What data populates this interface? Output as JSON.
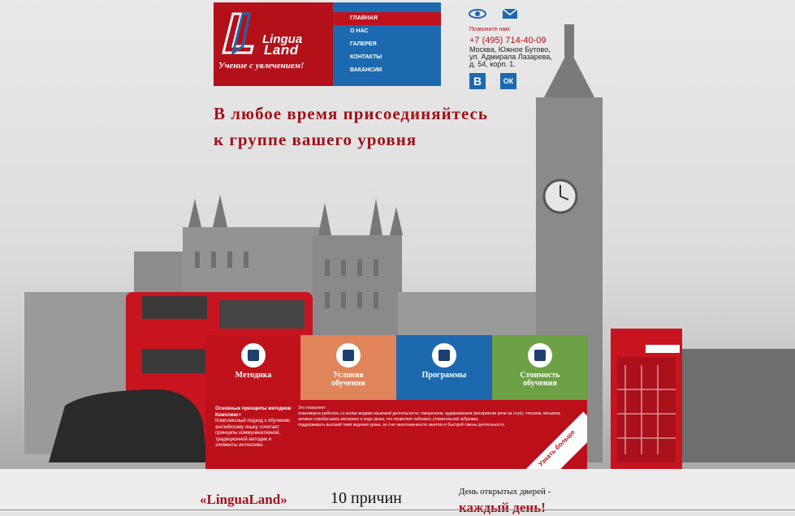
{
  "logo": {
    "line1": "Lingua",
    "line2": "Land",
    "slogan": "Учение с увлечением!"
  },
  "nav": {
    "items": [
      {
        "label": "ГЛАВНАЯ",
        "active": true
      },
      {
        "label": "О НАС",
        "active": false
      },
      {
        "label": "ГАЛЕРЕЯ",
        "active": false
      },
      {
        "label": "КОНТАКТЫ",
        "active": false
      },
      {
        "label": "ВАКАНСИИ",
        "active": false
      }
    ]
  },
  "contacts": {
    "call_label": "Позвоните нам:",
    "phone": "+7 (495) 714-40-09",
    "address": "Москва, Южное Бутово, ул. Адмирала Лазарева, д. 54, корп. 1.",
    "icons": [
      "eye-icon",
      "mail-icon"
    ],
    "social": [
      {
        "name": "vk-icon",
        "glyph": "В"
      },
      {
        "name": "ok-icon",
        "glyph": "ОК"
      }
    ]
  },
  "headline": {
    "line1": "В любое время присоединяйтесь",
    "line2": "к группе вашего уровня"
  },
  "tiles": [
    {
      "label": "Методика",
      "color": "#c0121d",
      "icon": "books-icon"
    },
    {
      "label": "Условия обучения",
      "color": "#e0845a",
      "icon": "people-icon"
    },
    {
      "label": "Программы",
      "color": "#1c69b0",
      "icon": "briefcase-icon"
    },
    {
      "label": "Стоимость обучения",
      "color": "#6da145",
      "icon": "document-icon"
    }
  ],
  "info": {
    "left_title": "Основные принципы методики Комплекс+",
    "left_text": "Комплексный подход к обучению английскому языку сочетает принципы коммуникативной, традиционной методик и элементы интенсива.",
    "right_text_1": "Это позволяет:",
    "right_text_2": "планомерно работать со всеми видами языковой деятельности: говорением, аудированием (восприятие речи на слух), чтением, письмом;",
    "right_text_3": "активно отрабатывать материал в ходе урока, что позволяет избежать утомительной зубрежки;",
    "right_text_4": "поддерживать высокий темп ведения урока, за счет многозначности занятия и быстрой смены деятельности.",
    "more_label": "Узнать больше"
  },
  "bottom": {
    "brand": "«LinguaLand»",
    "reasons": "10 причин",
    "open_day_1": "День открытых дверей -",
    "open_day_2": "каждый день!"
  },
  "colors": {
    "red": "#b3101a",
    "blue": "#1c69b0",
    "orange": "#e0845a",
    "green": "#6da145"
  }
}
